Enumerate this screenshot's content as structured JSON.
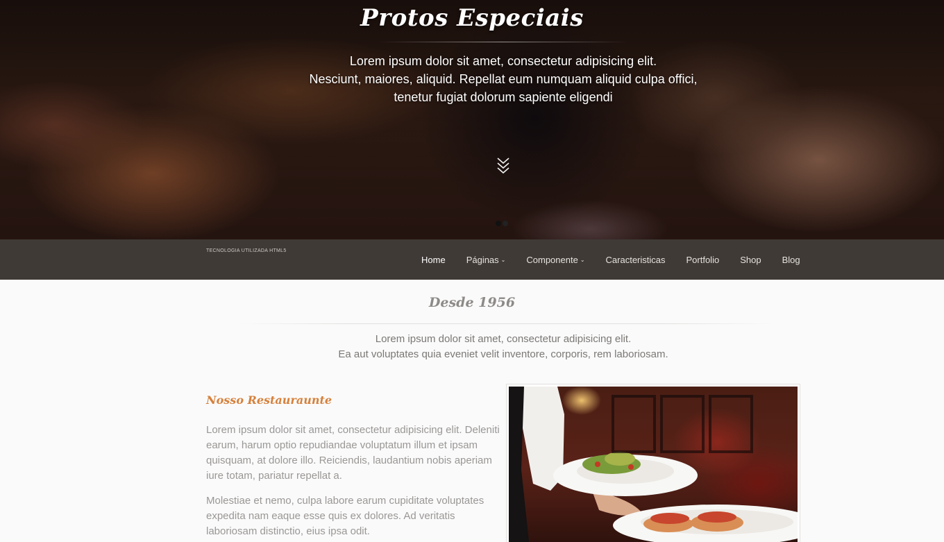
{
  "hero": {
    "title": "Protos Especiais",
    "lines": [
      "Lorem ipsum dolor sit amet, consectetur adipisicing elit.",
      "Nesciunt, maiores, aliquid. Repellat eum numquam aliquid culpa offici,",
      "tenetur fugiat dolorum sapiente eligendi"
    ],
    "scroll_icon": "double-chevron-down-icon",
    "slides": 2,
    "active_slide": 2
  },
  "navbar": {
    "brand": "TECNOLOGIA UTILIZADA HTML5",
    "items": [
      {
        "label": "Home",
        "active": true,
        "dropdown": false
      },
      {
        "label": "Páginas",
        "active": false,
        "dropdown": true
      },
      {
        "label": "Componente",
        "active": false,
        "dropdown": true
      },
      {
        "label": "Caracteristicas",
        "active": false,
        "dropdown": false
      },
      {
        "label": "Portfolio",
        "active": false,
        "dropdown": false
      },
      {
        "label": "Shop",
        "active": false,
        "dropdown": false
      },
      {
        "label": "Blog",
        "active": false,
        "dropdown": false
      }
    ],
    "caret": "⌄"
  },
  "intro": {
    "title": "Desde 1956",
    "lines": [
      "Lorem ipsum dolor sit amet, consectetur adipisicing elit.",
      "Ea aut voluptates quia eveniet velit inventore, corporis, rem laboriosam."
    ]
  },
  "restaurant": {
    "title": "Nosso Restauraunte",
    "paragraph1": "Lorem ipsum dolor sit amet, consectetur adipisicing elit. Deleniti earum, harum optio repudiandae voluptatum illum et ipsam quisquam, at dolore illo. Reiciendis, laudantium nobis aperiam iure totam, pariatur repellat a.",
    "paragraph2": "Molestiae et nemo, culpa labore earum cupiditate voluptates expedita nam eaque esse quis ex dolores. Ad veritatis laboriosam distinctio, eius ipsa odit."
  },
  "colors": {
    "navbar_bg": "#3f3a36",
    "accent_orange": "#d6813c",
    "page_bg": "#fafafa"
  }
}
